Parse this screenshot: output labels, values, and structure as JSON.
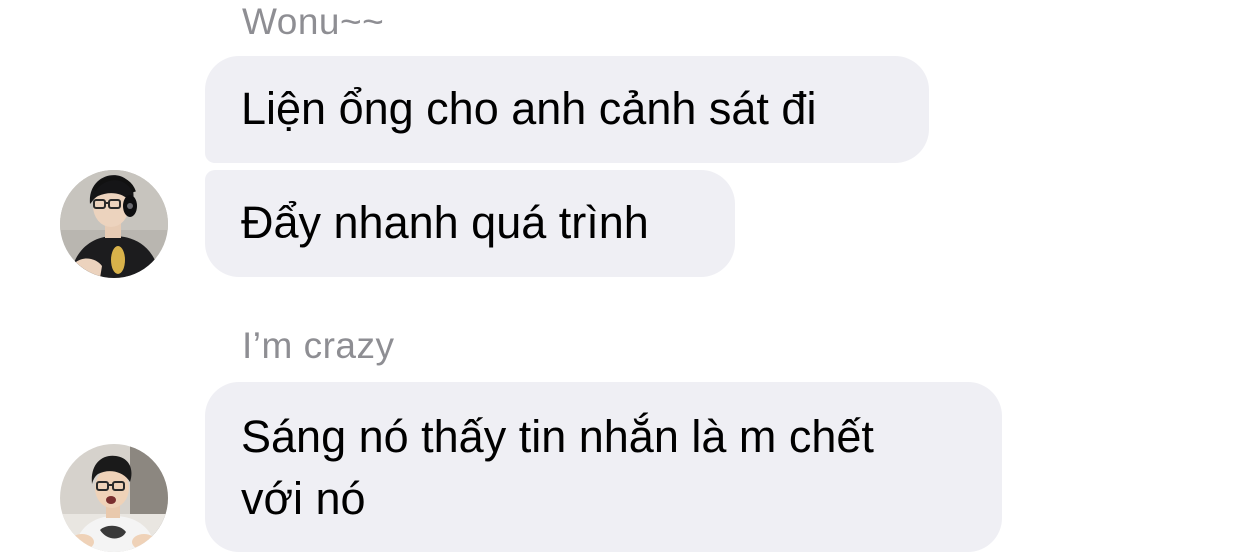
{
  "conversation": {
    "groups": [
      {
        "sender": "Wonu~~",
        "messages": [
          "Liện ổng cho anh cảnh sát đi",
          "Đẩy nhanh quá trình"
        ]
      },
      {
        "sender": "I’m crazy",
        "messages": [
          "Sáng nó thấy tin nhắn là m chết",
          "với nó"
        ]
      }
    ]
  },
  "colors": {
    "bubble_bg": "#efeff4",
    "sender_name": "#8e8e93",
    "text": "#000000"
  }
}
